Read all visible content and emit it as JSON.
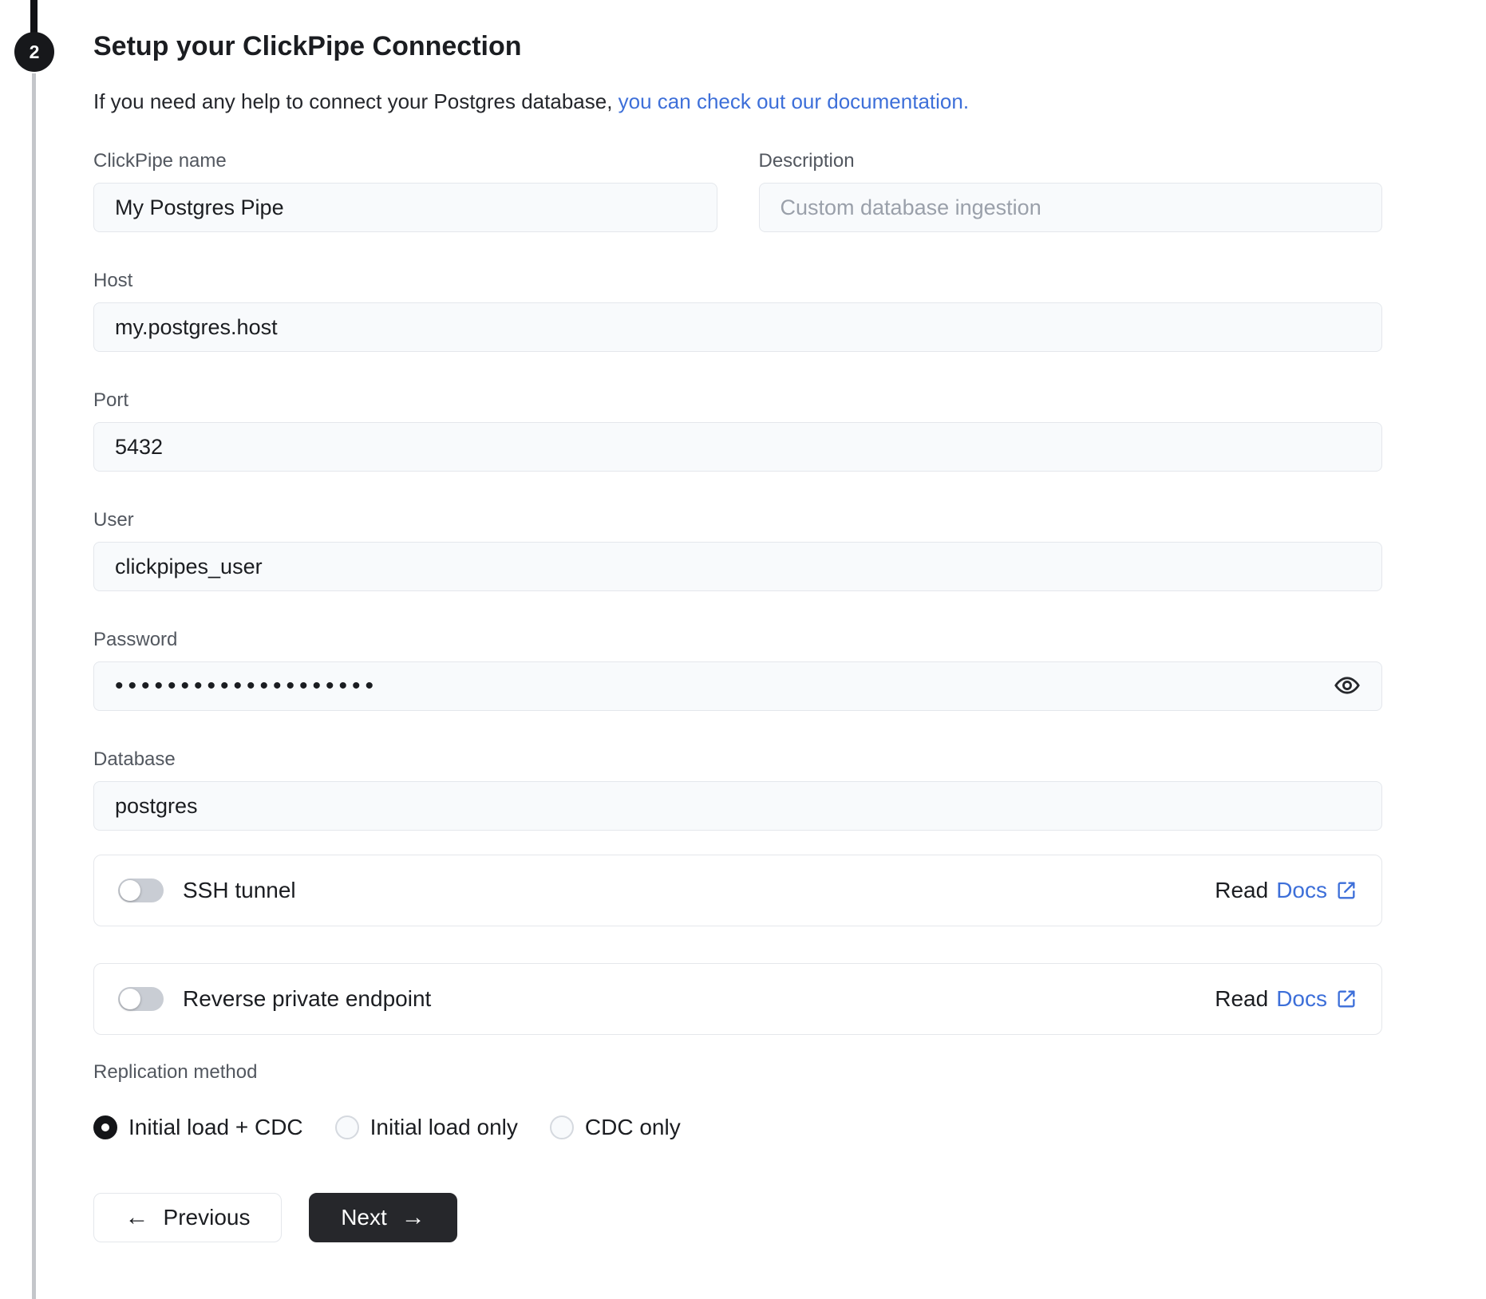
{
  "stepper": {
    "step_number": "2"
  },
  "header": {
    "title": "Setup your ClickPipe Connection",
    "subtitle_plain": "If you need any help to connect your Postgres database, ",
    "subtitle_link": "you can check out our documentation."
  },
  "form": {
    "clickpipe_name": {
      "label": "ClickPipe name",
      "value": "My Postgres Pipe"
    },
    "description": {
      "label": "Description",
      "placeholder": "Custom database ingestion"
    },
    "host": {
      "label": "Host",
      "value": "my.postgres.host"
    },
    "port": {
      "label": "Port",
      "value": "5432"
    },
    "user": {
      "label": "User",
      "value": "clickpipes_user"
    },
    "password": {
      "label": "Password",
      "value_masked": "••••••••••••••••••••"
    },
    "database": {
      "label": "Database",
      "value": "postgres"
    },
    "ssh_tunnel": {
      "label": "SSH tunnel",
      "enabled": false,
      "read_label": "Read",
      "docs_label": "Docs"
    },
    "reverse_private_endpoint": {
      "label": "Reverse private endpoint",
      "enabled": false,
      "read_label": "Read",
      "docs_label": "Docs"
    },
    "replication_method": {
      "label": "Replication method",
      "options": [
        {
          "label": "Initial load + CDC",
          "selected": true
        },
        {
          "label": "Initial load only",
          "selected": false
        },
        {
          "label": "CDC only",
          "selected": false
        }
      ]
    }
  },
  "actions": {
    "previous_label": "Previous",
    "next_label": "Next"
  },
  "icons": {
    "previous_arrow": "←",
    "next_arrow": "→"
  },
  "colors": {
    "link_blue": "#3D6FD9",
    "button_dark": "#26272B",
    "toggle_off": "#C9CDD4",
    "input_bg": "#F8FAFC",
    "step_badge": "#17181B"
  }
}
